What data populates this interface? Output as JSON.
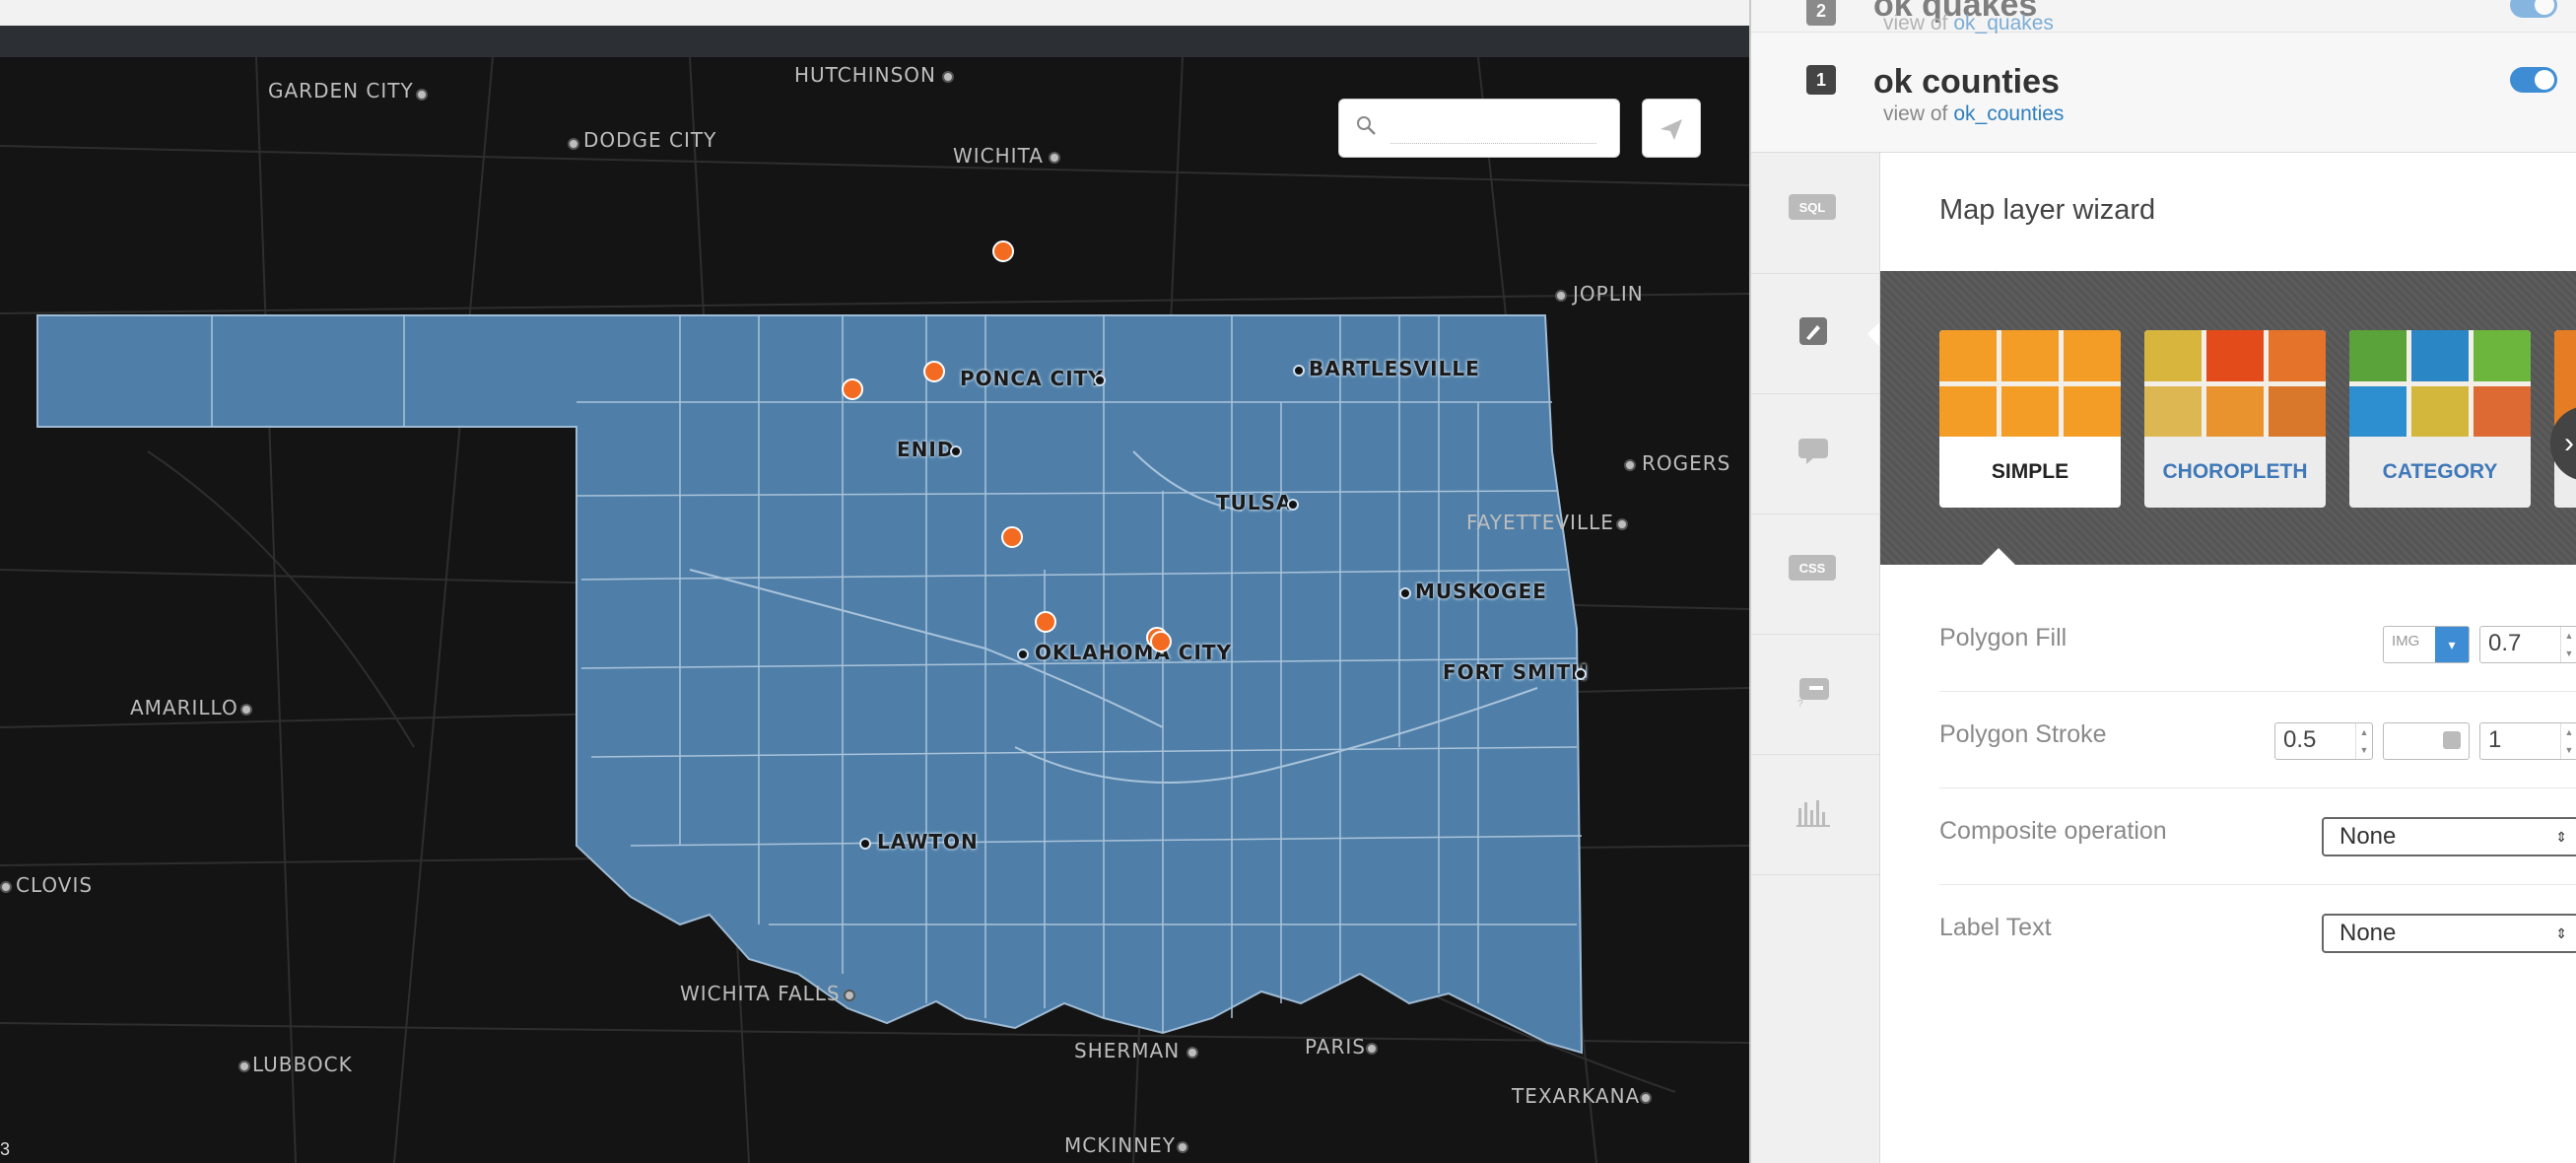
{
  "map": {
    "search": {
      "placeholder": ""
    },
    "corner_text": "3",
    "cities": [
      {
        "name": "GARDEN CITY"
      },
      {
        "name": "HUTCHINSON"
      },
      {
        "name": "DODGE CITY"
      },
      {
        "name": "WICHITA"
      },
      {
        "name": "JOPLIN"
      },
      {
        "name": "ROGERS"
      },
      {
        "name": "FAYETTEVILLE"
      },
      {
        "name": "AMARILLO"
      },
      {
        "name": "CLOVIS"
      },
      {
        "name": "WICHITA FALLS"
      },
      {
        "name": "LUBBOCK"
      },
      {
        "name": "SHERMAN"
      },
      {
        "name": "PARIS"
      },
      {
        "name": "TEXARKANA"
      },
      {
        "name": "MCKINNEY"
      }
    ],
    "ok_cities": [
      {
        "name": "PONCA CITY"
      },
      {
        "name": "BARTLESVILLE"
      },
      {
        "name": "ENID"
      },
      {
        "name": "TULSA"
      },
      {
        "name": "MUSKOGEE"
      },
      {
        "name": "OKLAHOMA CITY"
      },
      {
        "name": "FORT SMITH"
      },
      {
        "name": "LAWTON"
      }
    ],
    "colors": {
      "state_fill": "#4f7fa8",
      "quake_marker": "#f26b21"
    }
  },
  "layers": [
    {
      "number": "2",
      "title": "ok quakes",
      "view_of_label": "view of",
      "view_of_table": "ok_quakes"
    },
    {
      "number": "1",
      "title": "ok counties",
      "view_of_label": "view of",
      "view_of_table": "ok_counties"
    }
  ],
  "sidebar": {
    "items": [
      {
        "icon": "sql-icon",
        "text": "SQL"
      },
      {
        "icon": "brush-icon"
      },
      {
        "icon": "infowindow-icon"
      },
      {
        "icon": "css-icon",
        "text": "CSS"
      },
      {
        "icon": "legend-icon"
      },
      {
        "icon": "chart-icon"
      }
    ]
  },
  "wizard": {
    "title": "Map layer wizard",
    "cards": [
      {
        "label": "SIMPLE"
      },
      {
        "label": "CHOROPLETH"
      },
      {
        "label": "CATEGORY"
      }
    ],
    "props": {
      "polygon_fill": {
        "label": "Polygon Fill",
        "img_label": "IMG",
        "opacity": "0.7"
      },
      "polygon_stroke": {
        "label": "Polygon Stroke",
        "width": "0.5",
        "opacity": "1"
      },
      "composite": {
        "label": "Composite operation",
        "value": "None"
      },
      "label_text": {
        "label": "Label Text",
        "value": "None"
      }
    }
  }
}
